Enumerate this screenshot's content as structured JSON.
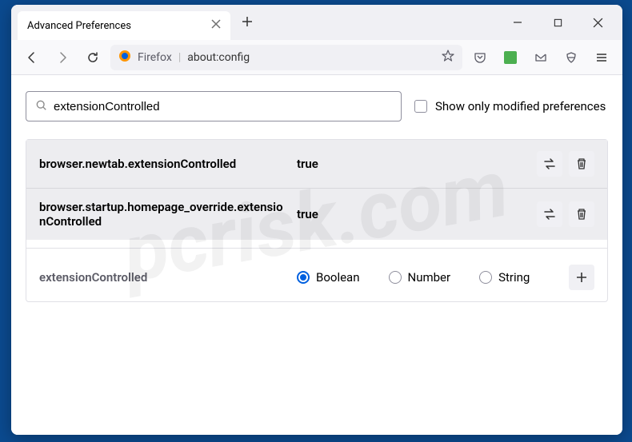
{
  "tab": {
    "title": "Advanced Preferences"
  },
  "urlbar": {
    "label": "Firefox",
    "url": "about:config"
  },
  "search": {
    "value": "extensionControlled"
  },
  "filter": {
    "label": "Show only modified preferences"
  },
  "prefs": [
    {
      "name": "browser.newtab.extensionControlled",
      "value": "true"
    },
    {
      "name": "browser.startup.homepage_override.extensionControlled",
      "value": "true"
    }
  ],
  "new_pref": {
    "name": "extensionControlled",
    "types": [
      "Boolean",
      "Number",
      "String"
    ],
    "selected": "Boolean"
  }
}
